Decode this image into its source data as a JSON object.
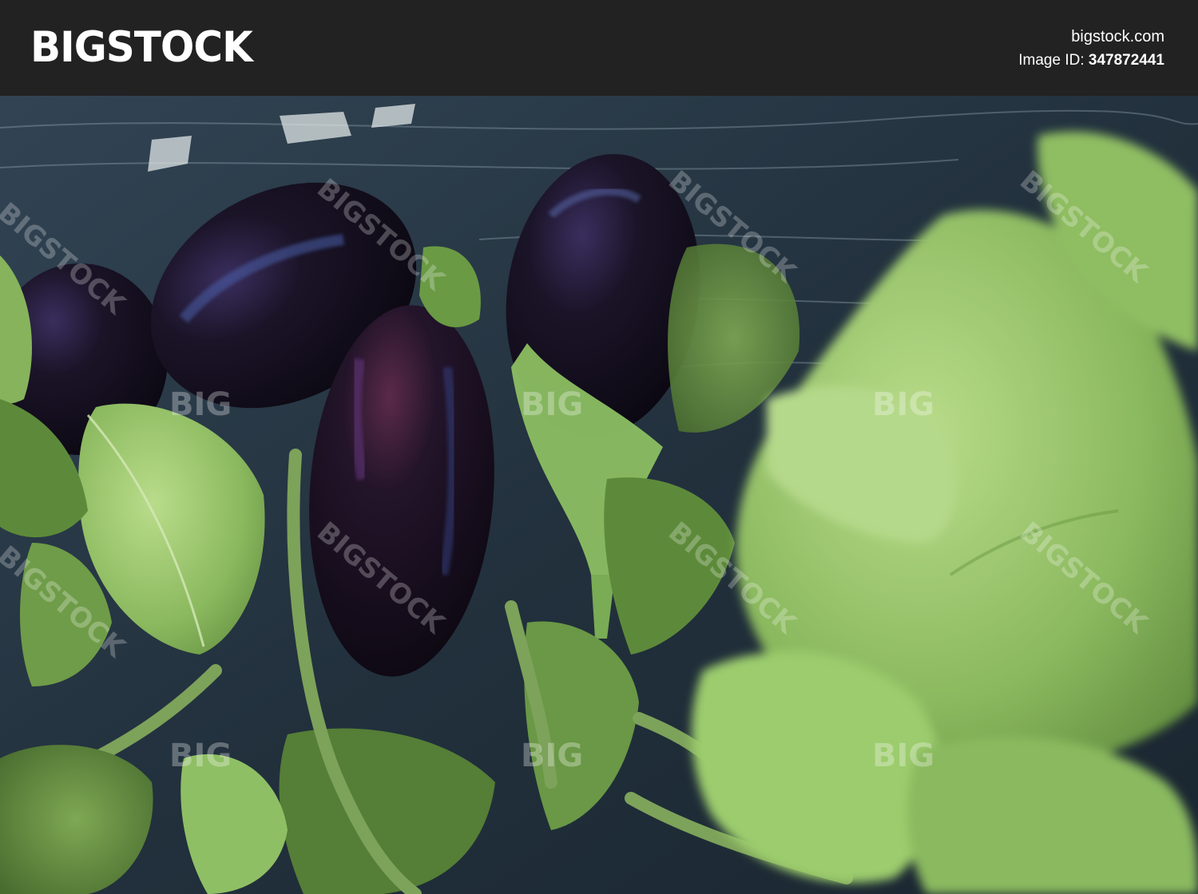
{
  "header": {
    "logo_text": "BIGSTOCK",
    "site": "bigstock.com",
    "image_id_label": "Image ID:",
    "image_id_value": "347872441"
  },
  "photo": {
    "watermark_text": "BIGSTOCK",
    "watermark_short": "BIG"
  },
  "colors": {
    "header_bg": "#222222",
    "plastic": "#2b3a48",
    "eggplant": "#17101e",
    "leaf": "#6f9a4a",
    "leaf_light": "#a9cf7b"
  }
}
